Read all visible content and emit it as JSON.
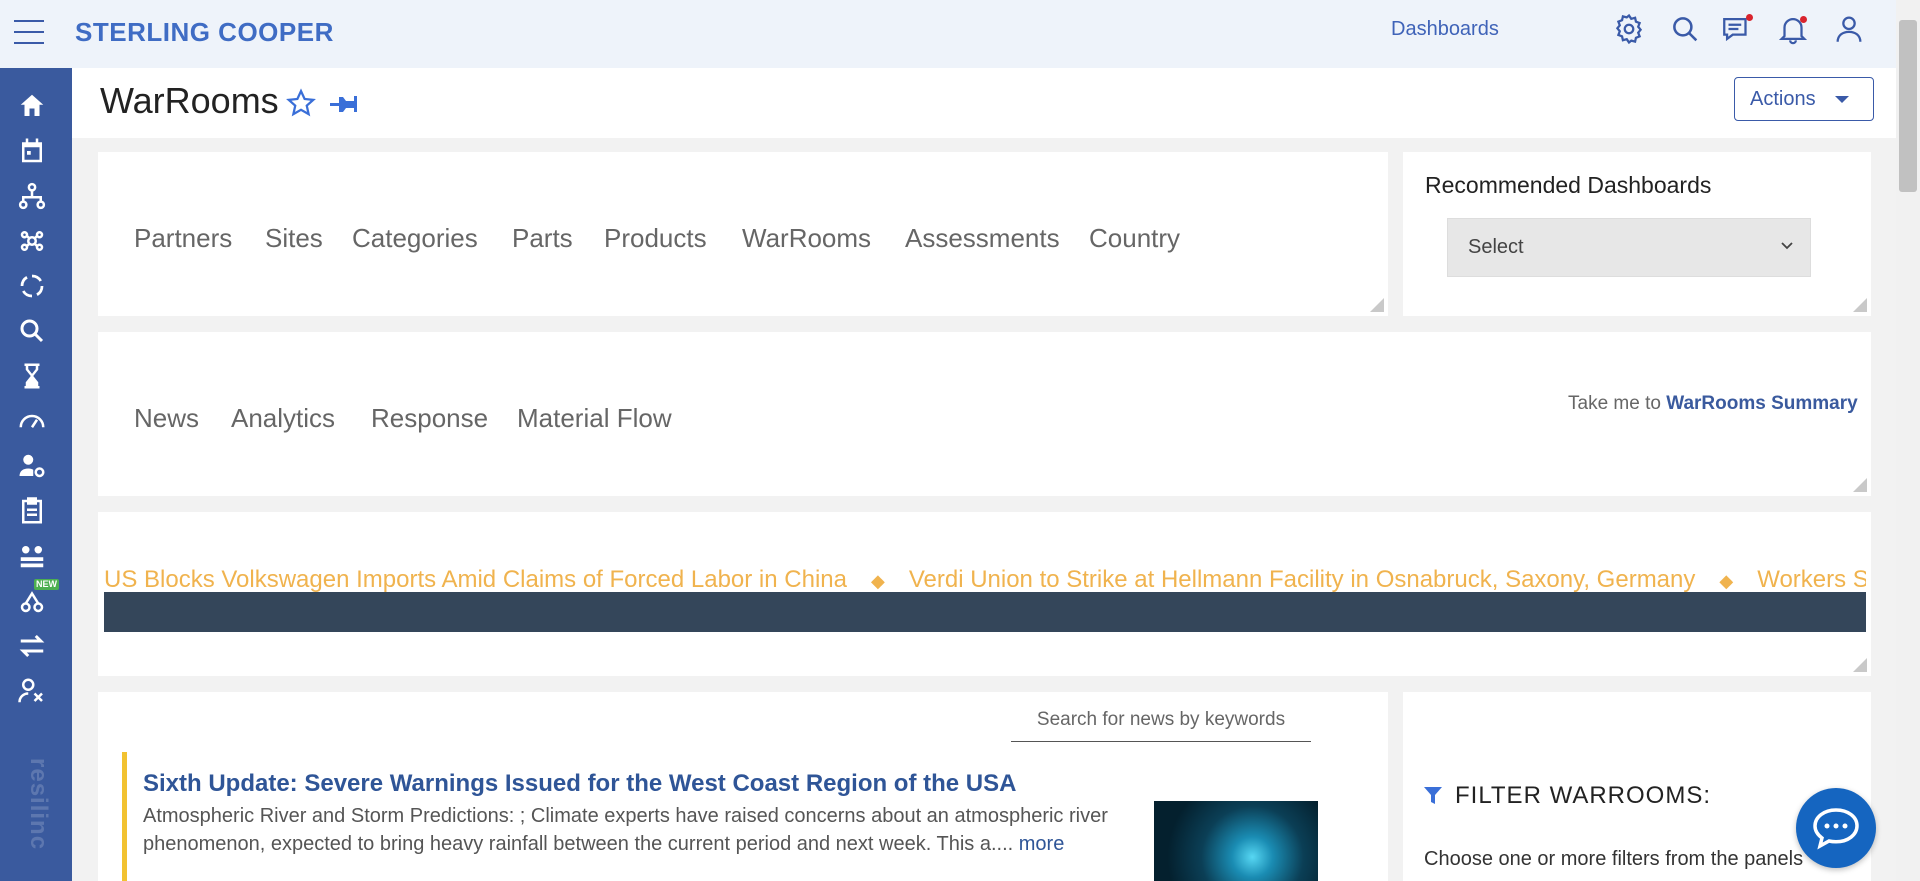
{
  "app": {
    "brand": "STERLING COOPER"
  },
  "topnav": {
    "dashboards_label": "Dashboards",
    "icons": [
      "gear-icon",
      "search-icon",
      "chat-icon",
      "bell-icon",
      "user-icon"
    ]
  },
  "sidebar": {
    "items": [
      {
        "icon": "home-icon"
      },
      {
        "icon": "calendar-icon"
      },
      {
        "icon": "hierarchy-icon"
      },
      {
        "icon": "network-icon"
      },
      {
        "icon": "cycle-icon"
      },
      {
        "icon": "search-person-icon"
      },
      {
        "icon": "hourglass-icon"
      },
      {
        "icon": "gauge-icon"
      },
      {
        "icon": "user-settings-icon"
      },
      {
        "icon": "clipboard-icon"
      },
      {
        "icon": "team-icon"
      },
      {
        "icon": "new-feature-icon",
        "badge": "NEW"
      },
      {
        "icon": "swap-icon"
      },
      {
        "icon": "admin-icon"
      }
    ],
    "logo_text": "resilinc"
  },
  "header": {
    "title": "WarRooms",
    "actions_label": "Actions"
  },
  "main_tabs": [
    "Partners",
    "Sites",
    "Categories",
    "Parts",
    "Products",
    "WarRooms",
    "Assessments",
    "Country"
  ],
  "recommended": {
    "title": "Recommended Dashboards",
    "select_value": "Select"
  },
  "sub_tabs": [
    "News",
    "Analytics",
    "Response",
    "Material Flow"
  ],
  "summary_link": {
    "prefix": "Take me to ",
    "link": "WarRooms Summary"
  },
  "ticker": {
    "items": [
      "US Blocks Volkswagen Imports Amid Claims of Forced Labor in China",
      "Verdi Union to Strike at Hellmann Facility in Osnabruck, Saxony, Germany",
      "Workers Stage I"
    ],
    "separator": "◆"
  },
  "news": {
    "search_placeholder": "Search for news by keywords",
    "items": [
      {
        "title": "Sixth Update: Severe Warnings Issued for the West Coast Region of the USA",
        "body": "Atmospheric River and Storm Predictions: ; Climate experts have raised concerns about an atmospheric river phenomenon, expected to bring heavy rainfall between the current period and next week. This a....",
        "more": "more"
      }
    ]
  },
  "filter": {
    "title": "FILTER  WARROOMS:",
    "description": "Choose one or more filters from the panels"
  },
  "colors": {
    "brand": "#3f6cc4",
    "sidebar": "#3a5a9e",
    "ticker_bg": "#34465a",
    "ticker_text": "#f0b34e",
    "news_accent": "#f2c230",
    "chat": "#1565c0"
  }
}
